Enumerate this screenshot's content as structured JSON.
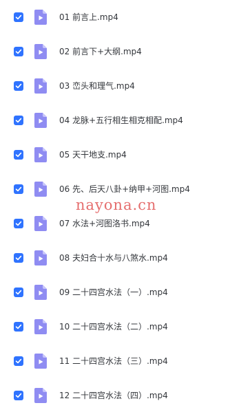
{
  "colors": {
    "checkbox": "#2f73ff",
    "file_icon": "#8f8cf2",
    "file_icon_fold": "#c7c5fa",
    "text": "#33363b",
    "watermark": "#dc3c3c"
  },
  "icons": {
    "checkbox": "checkmark-icon",
    "file": "video-file-icon"
  },
  "files": [
    {
      "name": "01 前言上.mp4",
      "checked": true
    },
    {
      "name": "02 前言下+大纲.mp4",
      "checked": true
    },
    {
      "name": "03 峦头和理气.mp4",
      "checked": true
    },
    {
      "name": "04 龙脉+五行相生相克相配.mp4",
      "checked": true
    },
    {
      "name": "05 天干地支.mp4",
      "checked": true
    },
    {
      "name": "06 先、后天八卦+纳甲+河图.mp4",
      "checked": true
    },
    {
      "name": "07 水法+河图洛书.mp4",
      "checked": true
    },
    {
      "name": "08 夫妇合十水与八煞水.mp4",
      "checked": true
    },
    {
      "name": "09 二十四宫水法（一）.mp4",
      "checked": true
    },
    {
      "name": "10 二十四宫水法（二）.mp4",
      "checked": true
    },
    {
      "name": "11 二十四宫水法（三）.mp4",
      "checked": true
    },
    {
      "name": "12 二十四宫水法（四）.mp4",
      "checked": true
    }
  ],
  "watermark": "nayona.cn"
}
